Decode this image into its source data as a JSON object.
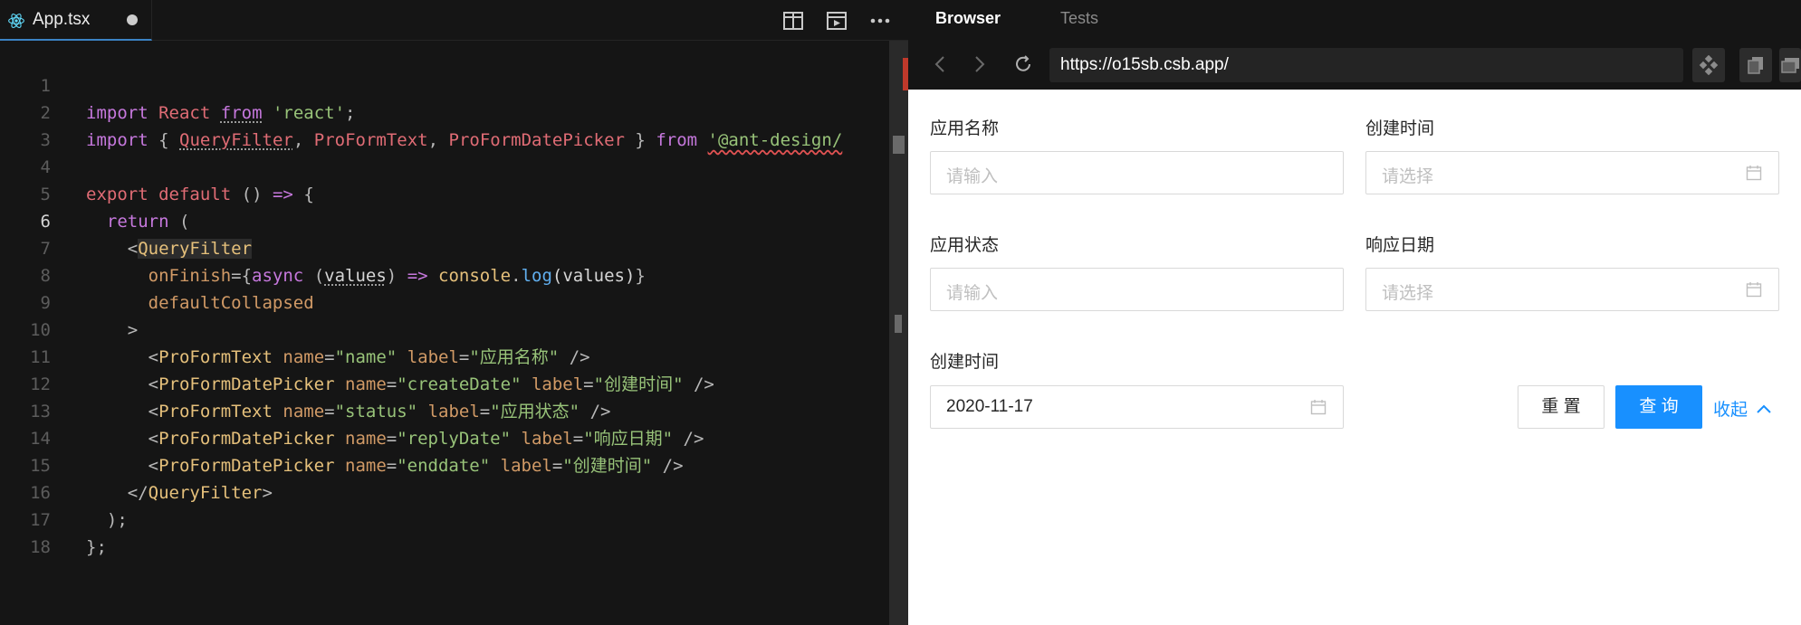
{
  "editor": {
    "tab": {
      "filename": "App.tsx",
      "icon": "react-icon",
      "unsaved": true
    },
    "actions": [
      "split-editor-icon",
      "preview-icon",
      "more-icon"
    ],
    "active_line": 6,
    "lines": [
      {
        "n": "1"
      },
      {
        "n": "2"
      },
      {
        "n": "3"
      },
      {
        "n": "4"
      },
      {
        "n": "5"
      },
      {
        "n": "6"
      },
      {
        "n": "7"
      },
      {
        "n": "8"
      },
      {
        "n": "9"
      },
      {
        "n": "10"
      },
      {
        "n": "11"
      },
      {
        "n": "12"
      },
      {
        "n": "13"
      },
      {
        "n": "14"
      },
      {
        "n": "15"
      },
      {
        "n": "16"
      },
      {
        "n": "17"
      },
      {
        "n": "18"
      }
    ],
    "code": {
      "l1": {
        "import": "import",
        "react": "React",
        "from": "from",
        "str": "'react'",
        "semi": ";"
      },
      "l2": {
        "import": "import",
        "open": "{",
        "a": "QueryFilter",
        "c1": ",",
        "b": "ProFormText",
        "c2": ",",
        "c": "ProFormDatePicker",
        "close": "}",
        "from": "from",
        "str": "'@ant-design/"
      },
      "l4": {
        "export": "export",
        "default": "default",
        "paren": "()",
        "arrow": "=>",
        "brace": "{"
      },
      "l5": {
        "return": "return",
        "paren": "("
      },
      "l6": {
        "lt": "<",
        "tag": "QueryFilter"
      },
      "l7": {
        "attr": "onFinish",
        "eq": "={",
        "async": "async",
        "param": "values",
        "arrow": "=>",
        "console": "console",
        "dot": ".",
        "log": "log",
        "args": "(values)",
        "close": "}"
      },
      "l8": {
        "attr": "defaultCollapsed"
      },
      "l9": {
        "gt": ">"
      },
      "l10": {
        "tag": "ProFormText",
        "name_attr": "name",
        "name_val": "\"name\"",
        "label_attr": "label",
        "label_val": "\"应用名称\"",
        "end": "/>"
      },
      "l11": {
        "tag": "ProFormDatePicker",
        "name_attr": "name",
        "name_val": "\"createDate\"",
        "label_attr": "label",
        "label_val": "\"创建时间\"",
        "end": "/>"
      },
      "l12": {
        "tag": "ProFormText",
        "name_attr": "name",
        "name_val": "\"status\"",
        "label_attr": "label",
        "label_val": "\"应用状态\"",
        "end": "/>"
      },
      "l13": {
        "tag": "ProFormDatePicker",
        "name_attr": "name",
        "name_val": "\"replyDate\"",
        "label_attr": "label",
        "label_val": "\"响应日期\"",
        "end": "/>"
      },
      "l14": {
        "tag": "ProFormDatePicker",
        "name_attr": "name",
        "name_val": "\"enddate\"",
        "label_attr": "label",
        "label_val": "\"创建时间\"",
        "end": "/>"
      },
      "l15": {
        "open": "</",
        "tag": "QueryFilter",
        "close": ">"
      },
      "l16": {
        "text": ");"
      },
      "l17": {
        "text": "};"
      }
    }
  },
  "browser": {
    "tabs": {
      "active": "Browser",
      "inactive": "Tests"
    },
    "url": "https://o15sb.csb.app/",
    "nav_icons": [
      "back-icon",
      "forward-icon",
      "refresh-icon"
    ],
    "tool_icons": [
      "devtools-icon",
      "copy-icon",
      "windows-icon"
    ],
    "form": {
      "f1": {
        "label": "应用名称",
        "placeholder": "请输入"
      },
      "f2": {
        "label": "创建时间",
        "placeholder": "请选择"
      },
      "f3": {
        "label": "应用状态",
        "placeholder": "请输入"
      },
      "f4": {
        "label": "响应日期",
        "placeholder": "请选择"
      },
      "f5": {
        "label": "创建时间",
        "value": "2020-11-17"
      },
      "reset": "重 置",
      "query": "查 询",
      "collapse": "收起"
    },
    "accent": "#1890ff"
  }
}
